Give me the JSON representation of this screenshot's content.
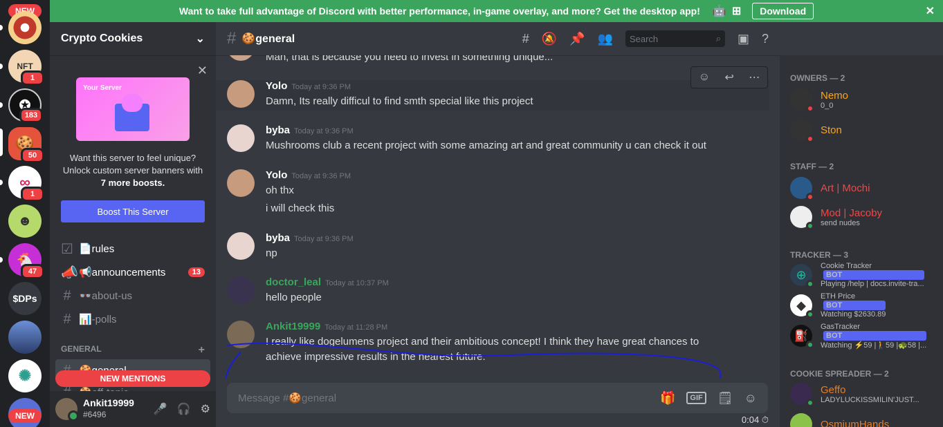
{
  "banner": {
    "text": "Want to take full advantage of Discord with better performance, in-game overlay, and more? Get the desktop app!",
    "download_label": "Download"
  },
  "rail": {
    "new_top": "NEW",
    "new_bottom": "NEW",
    "servers": [
      {
        "badge": ""
      },
      {
        "badge": "1"
      },
      {
        "badge": "183"
      },
      {
        "badge": "50"
      },
      {
        "badge": "1"
      },
      {
        "badge": ""
      },
      {
        "badge": "47"
      },
      {
        "label": "$DPs",
        "badge": ""
      },
      {
        "badge": ""
      },
      {
        "badge": ""
      }
    ]
  },
  "server": {
    "name": "Crypto Cookies",
    "boost_art_label": "Your Server",
    "boost_text_1": "Want this server to feel unique? Unlock custom server banners with",
    "boost_text_2": "7 more boosts.",
    "boost_button": "Boost This Server",
    "channels": [
      {
        "name": "📄rules"
      },
      {
        "name": "📢announcements",
        "count": "13"
      },
      {
        "name": "👓about-us"
      },
      {
        "name": "📊-polls"
      }
    ],
    "category": "GENERAL",
    "current_channel": "🍪general",
    "next_channel": "🍪off-topic",
    "new_mentions": "NEW MENTIONS"
  },
  "user": {
    "name": "Ankit19999",
    "tag": "#6496"
  },
  "channel_header": {
    "title": "🍪general",
    "search_placeholder": "Search"
  },
  "messages": [
    {
      "line": "Man, that is because you need to invest in something unique..."
    },
    {
      "author": "Yolo",
      "time": "Today at 9:36 PM",
      "lines": [
        "Damn, Its really difficul to find smth special like this project"
      ]
    },
    {
      "author": "byba",
      "time": "Today at 9:36 PM",
      "lines": [
        "Mushrooms club a recent project with some amazing art and great community u can check it out"
      ]
    },
    {
      "author": "Yolo",
      "time": "Today at 9:36 PM",
      "lines": [
        "oh thx",
        "i will check this"
      ]
    },
    {
      "author": "byba",
      "time": "Today at 9:36 PM",
      "lines": [
        "np"
      ]
    },
    {
      "author": "doctor_leal",
      "time": "Today at 10:37 PM",
      "lines": [
        "hello people"
      ]
    },
    {
      "author": "Ankit19999",
      "time": "Today at 11:28 PM",
      "lines": [
        "I really like dogelumens  project and their ambitious concept! I think they have great chances to",
        "achieve impressive results in the nearest future."
      ]
    }
  ],
  "composer": {
    "placeholder": "Message #🍪general",
    "gif": "GIF",
    "timer": "0:04"
  },
  "members": {
    "categories": [
      "OWNERS — 2",
      "STAFF — 2",
      "TRACKER — 3",
      "COOKIE SPREADER — 2"
    ],
    "owners": [
      {
        "name": "Nemo",
        "status": "0_0"
      },
      {
        "name": "Ston",
        "status": ""
      }
    ],
    "staff": [
      {
        "name": "Art | Mochi",
        "status": ""
      },
      {
        "name": "Mod | Jacoby",
        "status": "send nudes"
      }
    ],
    "tracker": [
      {
        "name": "Cookie Tracker",
        "status": "Playing /help | docs.invite-tra..."
      },
      {
        "name": "ETH Price",
        "status": "Watching $2630.89"
      },
      {
        "name": "GasTracker",
        "status": "Watching ⚡59 |🚶59 |🐢58 |..."
      }
    ],
    "spreader": [
      {
        "name": "Geffo",
        "status": "LADYLUCKISSMILIN'JUST..."
      },
      {
        "name": "OsmiumHands",
        "status": ""
      }
    ],
    "bot_tag": "BOT"
  },
  "colors": {
    "owner": "#faa61a",
    "staff": "#f04747",
    "tracker": "#b44ee6",
    "spreader": "#e67e22",
    "online": "#3ba55d",
    "dnd": "#ed4245"
  }
}
